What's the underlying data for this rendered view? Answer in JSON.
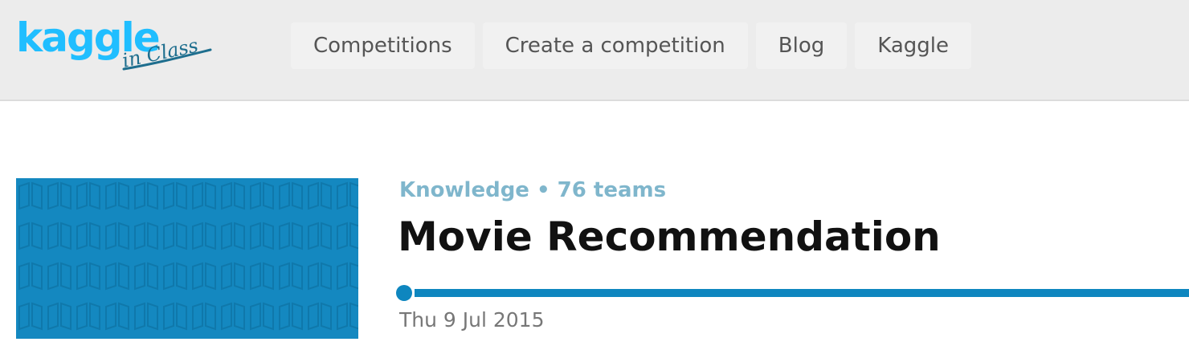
{
  "header": {
    "logo_text": "kaggle",
    "logo_subtext": "in Class",
    "nav": [
      {
        "label": "Competitions"
      },
      {
        "label": "Create a competition"
      },
      {
        "label": "Blog"
      },
      {
        "label": "Kaggle"
      }
    ]
  },
  "competition": {
    "category": "Knowledge",
    "separator": "•",
    "teams": "76 teams",
    "meta_line": "Knowledge • 76 teams",
    "title": "Movie Recommendation",
    "start_date": "Thu 9 Jul 2015"
  },
  "colors": {
    "brand": "#20beff",
    "accent": "#0e86bf",
    "banner": "#1488c0"
  }
}
